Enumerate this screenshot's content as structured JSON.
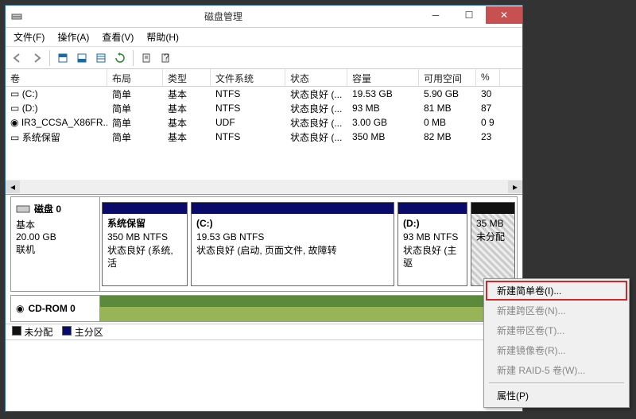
{
  "title": "磁盘管理",
  "menu": {
    "file": "文件(F)",
    "action": "操作(A)",
    "view": "查看(V)",
    "help": "帮助(H)"
  },
  "columns": {
    "vol": "卷",
    "layout": "布局",
    "type": "类型",
    "fs": "文件系统",
    "status": "状态",
    "cap": "容量",
    "free": "可用空间",
    "pct": "%"
  },
  "rows": [
    {
      "vol": "(C:)",
      "layout": "简单",
      "type": "基本",
      "fs": "NTFS",
      "status": "状态良好 (...",
      "cap": "19.53 GB",
      "free": "5.90 GB",
      "pct": "30"
    },
    {
      "vol": "(D:)",
      "layout": "简单",
      "type": "基本",
      "fs": "NTFS",
      "status": "状态良好 (...",
      "cap": "93 MB",
      "free": "81 MB",
      "pct": "87"
    },
    {
      "vol": "IR3_CCSA_X86FR...",
      "layout": "简单",
      "type": "基本",
      "fs": "UDF",
      "status": "状态良好 (...",
      "cap": "3.00 GB",
      "free": "0 MB",
      "pct": "0 9"
    },
    {
      "vol": "系统保留",
      "layout": "简单",
      "type": "基本",
      "fs": "NTFS",
      "status": "状态良好 (...",
      "cap": "350 MB",
      "free": "82 MB",
      "pct": "23"
    }
  ],
  "disk0": {
    "name": "磁盘 0",
    "type": "基本",
    "size": "20.00 GB",
    "state": "联机"
  },
  "parts": {
    "p1": {
      "name": "系统保留",
      "size": "350 MB NTFS",
      "stat": "状态良好 (系统, 活"
    },
    "p2": {
      "name": "(C:)",
      "size": "19.53 GB NTFS",
      "stat": "状态良好 (启动, 页面文件, 故障转"
    },
    "p3": {
      "name": "(D:)",
      "size": "93 MB NTFS",
      "stat": "状态良好 (主驱"
    },
    "p4": {
      "name": "",
      "size": "35 MB",
      "stat": "未分配"
    }
  },
  "cdrom": {
    "name": "CD-ROM 0"
  },
  "legend": {
    "unalloc": "未分配",
    "primary": "主分区"
  },
  "ctx": {
    "i1": "新建简单卷(I)...",
    "i2": "新建跨区卷(N)...",
    "i3": "新建带区卷(T)...",
    "i4": "新建镜像卷(R)...",
    "i5": "新建 RAID-5 卷(W)...",
    "i6": "属性(P)"
  }
}
